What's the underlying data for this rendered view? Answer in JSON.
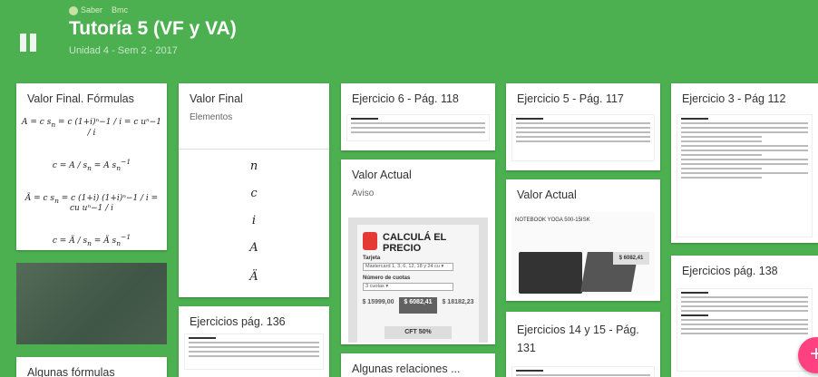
{
  "header": {
    "user": "Saber",
    "section": "Bmc",
    "title": "Tutoría 5 (VF y VA)",
    "subtitle": "Unidad 4 - Sem 2 - 2017"
  },
  "cards": {
    "formulas": {
      "title": "Valor Final. Fórmulas"
    },
    "valor_final": {
      "title": "Valor Final",
      "sub": "Elementos",
      "vars": [
        "n",
        "c",
        "i",
        "A",
        "Ä"
      ]
    },
    "ej136": {
      "title": "Ejercicios pág. 136"
    },
    "algunas_formulas": {
      "title": "Algunas fórmulas"
    },
    "ej6": {
      "title": "Ejercicio 6 - Pág. 118"
    },
    "valor_actual_aviso": {
      "title": "Valor Actual",
      "sub": "Aviso"
    },
    "algunas_relaciones": {
      "title": "Algunas relaciones ..."
    },
    "ej5": {
      "title": "Ejercicio 5 - Pág. 117"
    },
    "valor_actual_2": {
      "title": "Valor Actual"
    },
    "ej14_15": {
      "title": "Ejercicios 14 y 15 - Pág. 131"
    },
    "ej3": {
      "title": "Ejercicio 3 - Pág 112"
    },
    "ej138": {
      "title": "Ejercicios pág. 138"
    }
  },
  "ad": {
    "headline": "CALCULÁ EL PRECIO",
    "tarjeta_label": "Tarjeta",
    "tarjeta_value": "Mastercard 1, 3, 6, 12, 18 y 24 cu ▾",
    "cuotas_label": "Número de cuotas",
    "cuotas_value": "3 cuotas ▾",
    "prices": [
      "$ 15999,00",
      "$ 6082,41",
      "$ 18182,23"
    ],
    "cft": "CFT 50%"
  },
  "product": {
    "name": "NOTEBOOK YOGA 500-15ISK",
    "price": "$ 6082,41"
  },
  "fab_label": "+"
}
